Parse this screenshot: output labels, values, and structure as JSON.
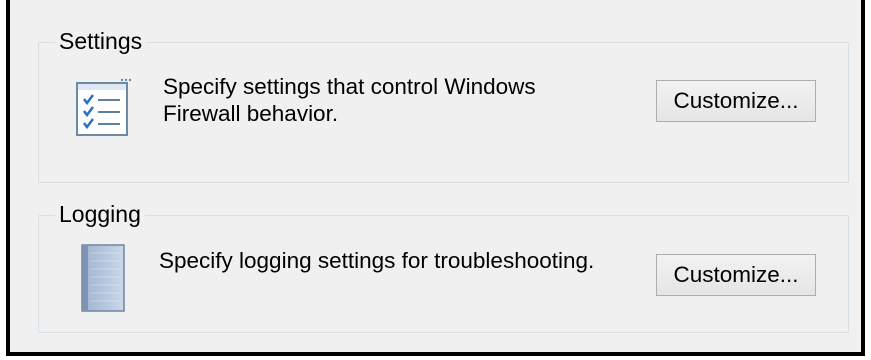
{
  "settings_group": {
    "title": "Settings",
    "description": "Specify settings that control Windows Firewall behavior.",
    "button_label": "Customize...",
    "icon": "checklist-icon"
  },
  "logging_group": {
    "title": "Logging",
    "description": "Specify logging settings for troubleshooting.",
    "button_label": "Customize...",
    "icon": "notebook-icon"
  },
  "colors": {
    "background": "#f0f0f0",
    "group_border": "#d5dfe5",
    "button_border": "#adadad",
    "frame_border": "#000000"
  }
}
